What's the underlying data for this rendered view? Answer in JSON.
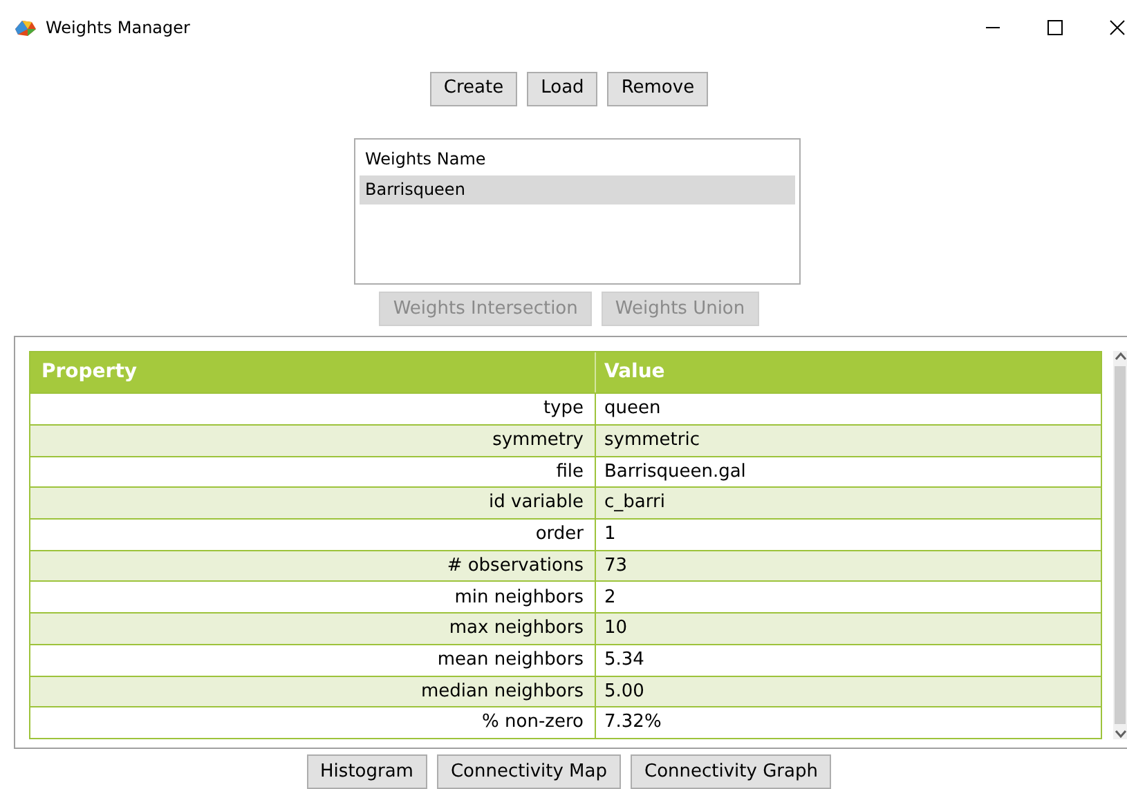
{
  "window": {
    "title": "Weights Manager"
  },
  "top_buttons": [
    {
      "label": "Create",
      "disabled": false
    },
    {
      "label": "Load",
      "disabled": false
    },
    {
      "label": "Remove",
      "disabled": false
    }
  ],
  "weights_list": {
    "header": "Weights Name",
    "items": [
      {
        "label": "Barrisqueen",
        "selected": true
      }
    ]
  },
  "set_buttons": [
    {
      "label": "Weights Intersection",
      "disabled": true
    },
    {
      "label": "Weights Union",
      "disabled": true
    }
  ],
  "table": {
    "columns": [
      "Property",
      "Value"
    ],
    "rows": [
      [
        "type",
        "queen"
      ],
      [
        "symmetry",
        "symmetric"
      ],
      [
        "file",
        "Barrisqueen.gal"
      ],
      [
        "id variable",
        "c_barri"
      ],
      [
        "order",
        "1"
      ],
      [
        "# observations",
        "73"
      ],
      [
        "min neighbors",
        "2"
      ],
      [
        "max neighbors",
        "10"
      ],
      [
        "mean neighbors",
        "5.34"
      ],
      [
        "median neighbors",
        "5.00"
      ],
      [
        "% non-zero",
        "7.32%"
      ]
    ]
  },
  "bottom_buttons": [
    {
      "label": "Histogram",
      "disabled": false
    },
    {
      "label": "Connectivity Map",
      "disabled": false
    },
    {
      "label": "Connectivity Graph",
      "disabled": false
    }
  ]
}
